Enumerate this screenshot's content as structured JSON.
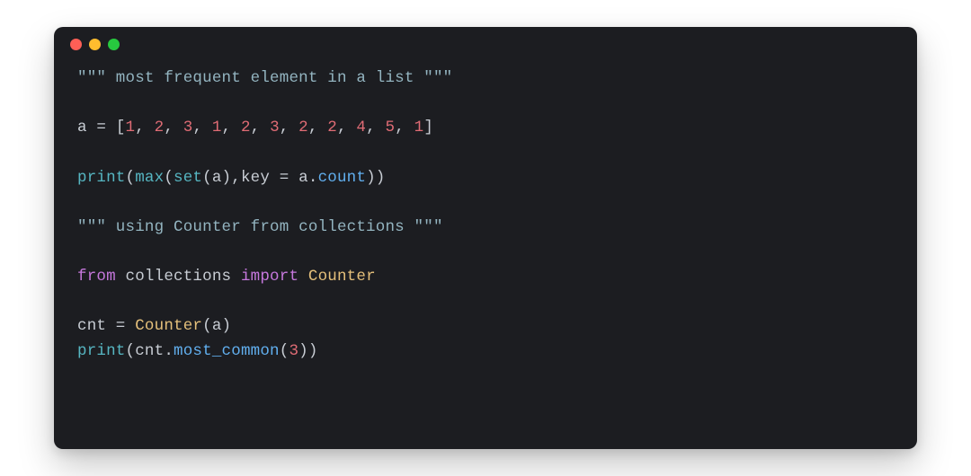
{
  "window": {
    "dots": [
      "red",
      "yellow",
      "green"
    ]
  },
  "colors": {
    "background": "#1c1d21",
    "string": "#93b4c0",
    "number": "#e06c75",
    "builtin": "#56b6c2",
    "keyword": "#c678dd",
    "class": "#e5c07b",
    "method": "#61afef",
    "default": "#c8cdd4"
  },
  "code": {
    "lines": [
      [
        {
          "t": "str",
          "v": "\"\"\" most frequent element in a list \"\"\""
        }
      ],
      [],
      [
        {
          "t": "ident",
          "v": "a"
        },
        {
          "t": "op",
          "v": " = "
        },
        {
          "t": "punc",
          "v": "["
        },
        {
          "t": "num",
          "v": "1"
        },
        {
          "t": "punc",
          "v": ", "
        },
        {
          "t": "num",
          "v": "2"
        },
        {
          "t": "punc",
          "v": ", "
        },
        {
          "t": "num",
          "v": "3"
        },
        {
          "t": "punc",
          "v": ", "
        },
        {
          "t": "num",
          "v": "1"
        },
        {
          "t": "punc",
          "v": ", "
        },
        {
          "t": "num",
          "v": "2"
        },
        {
          "t": "punc",
          "v": ", "
        },
        {
          "t": "num",
          "v": "3"
        },
        {
          "t": "punc",
          "v": ", "
        },
        {
          "t": "num",
          "v": "2"
        },
        {
          "t": "punc",
          "v": ", "
        },
        {
          "t": "num",
          "v": "2"
        },
        {
          "t": "punc",
          "v": ", "
        },
        {
          "t": "num",
          "v": "4"
        },
        {
          "t": "punc",
          "v": ", "
        },
        {
          "t": "num",
          "v": "5"
        },
        {
          "t": "punc",
          "v": ", "
        },
        {
          "t": "num",
          "v": "1"
        },
        {
          "t": "punc",
          "v": "]"
        }
      ],
      [],
      [
        {
          "t": "builtin",
          "v": "print"
        },
        {
          "t": "punc",
          "v": "("
        },
        {
          "t": "builtin",
          "v": "max"
        },
        {
          "t": "punc",
          "v": "("
        },
        {
          "t": "builtin",
          "v": "set"
        },
        {
          "t": "punc",
          "v": "("
        },
        {
          "t": "ident",
          "v": "a"
        },
        {
          "t": "punc",
          "v": "),"
        },
        {
          "t": "ident",
          "v": "key"
        },
        {
          "t": "op",
          "v": " = "
        },
        {
          "t": "ident",
          "v": "a"
        },
        {
          "t": "punc",
          "v": "."
        },
        {
          "t": "method",
          "v": "count"
        },
        {
          "t": "punc",
          "v": "))"
        }
      ],
      [],
      [
        {
          "t": "str",
          "v": "\"\"\" using Counter from collections \"\"\""
        }
      ],
      [],
      [
        {
          "t": "kw",
          "v": "from"
        },
        {
          "t": "ident",
          "v": " "
        },
        {
          "t": "module",
          "v": "collections"
        },
        {
          "t": "ident",
          "v": " "
        },
        {
          "t": "kw",
          "v": "import"
        },
        {
          "t": "ident",
          "v": " "
        },
        {
          "t": "class",
          "v": "Counter"
        }
      ],
      [],
      [
        {
          "t": "ident",
          "v": "cnt"
        },
        {
          "t": "op",
          "v": " = "
        },
        {
          "t": "class",
          "v": "Counter"
        },
        {
          "t": "punc",
          "v": "("
        },
        {
          "t": "ident",
          "v": "a"
        },
        {
          "t": "punc",
          "v": ")"
        }
      ],
      [
        {
          "t": "builtin",
          "v": "print"
        },
        {
          "t": "punc",
          "v": "("
        },
        {
          "t": "ident",
          "v": "cnt"
        },
        {
          "t": "punc",
          "v": "."
        },
        {
          "t": "method",
          "v": "most_common"
        },
        {
          "t": "punc",
          "v": "("
        },
        {
          "t": "num",
          "v": "3"
        },
        {
          "t": "punc",
          "v": "))"
        }
      ]
    ]
  }
}
